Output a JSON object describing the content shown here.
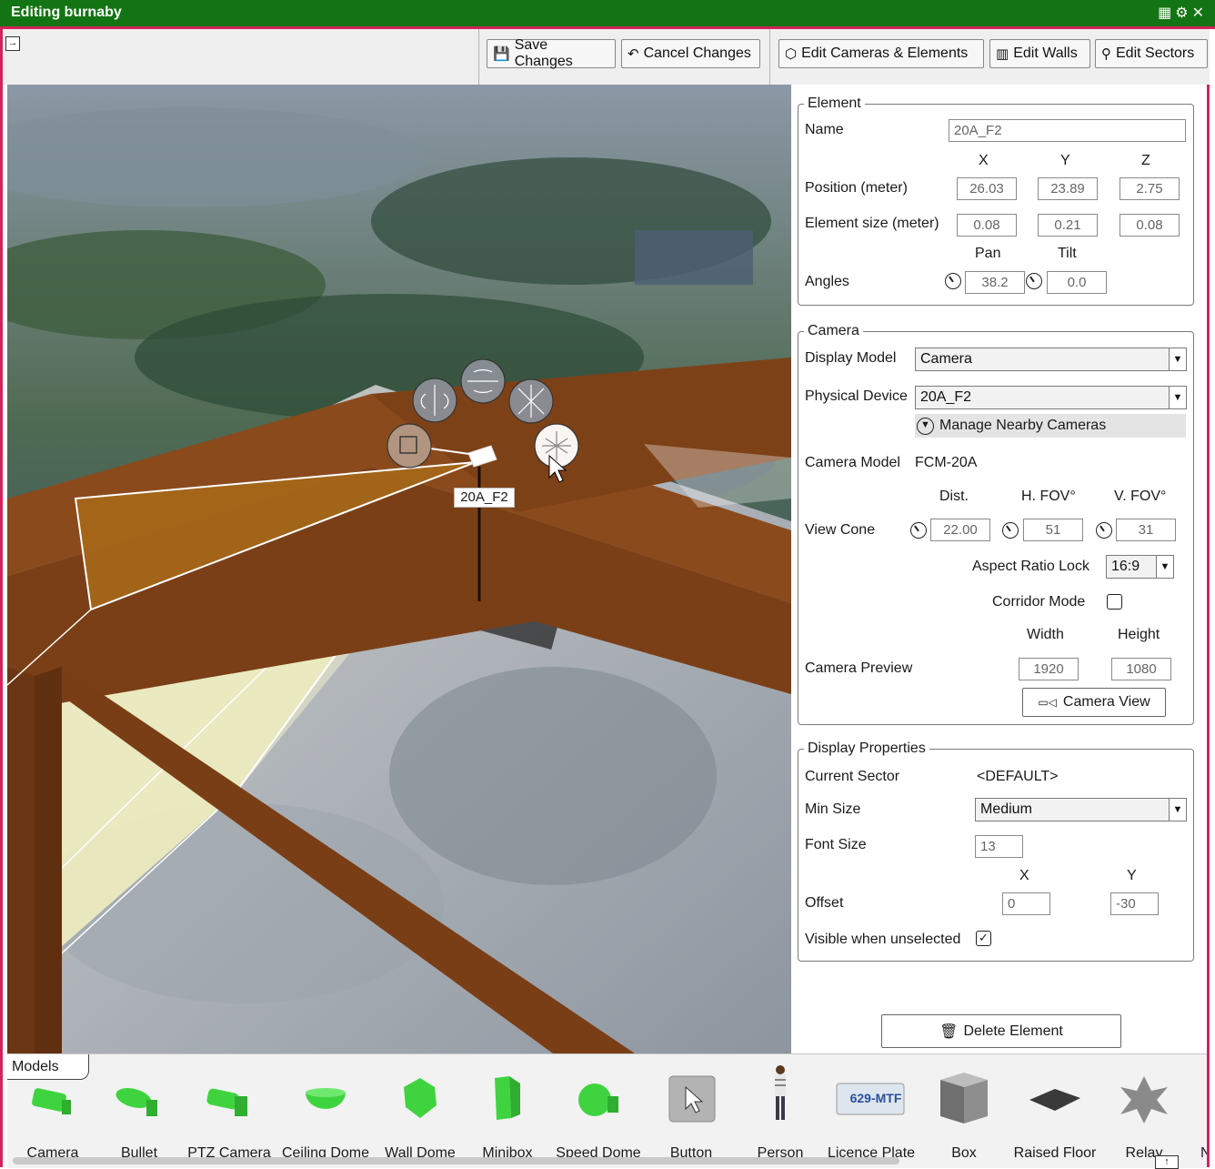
{
  "window": {
    "title": "Editing burnaby",
    "icons": [
      "layout-icon",
      "gear-icon",
      "close-icon"
    ]
  },
  "toolbar": {
    "save_label": "Save Changes",
    "cancel_label": "Cancel Changes",
    "edit_cameras_label": "Edit Cameras & Elements",
    "edit_walls_label": "Edit Walls",
    "edit_sectors_label": "Edit Sectors"
  },
  "viewport": {
    "camera_label": "20A_F2",
    "colors": {
      "wall": "#8a4a1c",
      "cone": "#f1efb8",
      "selection": "#ffffff"
    }
  },
  "element": {
    "legend": "Element",
    "name_label": "Name",
    "name_value": "20A_F2",
    "col_x": "X",
    "col_y": "Y",
    "col_z": "Z",
    "position_label": "Position (meter)",
    "position": {
      "x": "26.03",
      "y": "23.89",
      "z": "2.75"
    },
    "size_label": "Element size (meter)",
    "size": {
      "x": "0.08",
      "y": "0.21",
      "z": "0.08"
    },
    "pan_label": "Pan",
    "tilt_label": "Tilt",
    "angles_label": "Angles",
    "pan": "38.2",
    "tilt": "0.0"
  },
  "camera": {
    "legend": "Camera",
    "display_model_label": "Display Model",
    "display_model": "Camera",
    "physical_device_label": "Physical Device",
    "physical_device": "20A_F2",
    "manage_nearby": "Manage Nearby Cameras",
    "camera_model_label": "Camera Model",
    "camera_model": "FCM-20A",
    "dist_label": "Dist.",
    "hfov_label": "H. FOV°",
    "vfov_label": "V. FOV°",
    "view_cone_label": "View Cone",
    "dist": "22.00",
    "hfov": "51",
    "vfov": "31",
    "aspect_label": "Aspect Ratio Lock",
    "aspect": "16:9",
    "corridor_label": "Corridor Mode",
    "corridor_checked": false,
    "width_label": "Width",
    "height_label": "Height",
    "preview_label": "Camera Preview",
    "width": "1920",
    "height": "1080",
    "camera_view_button": "Camera View"
  },
  "display": {
    "legend": "Display Properties",
    "sector_label": "Current Sector",
    "sector": "<DEFAULT>",
    "min_size_label": "Min Size",
    "min_size": "Medium",
    "font_size_label": "Font Size",
    "font_size": "13",
    "col_x": "X",
    "col_y": "Y",
    "offset_label": "Offset",
    "offset_x": "0",
    "offset_y": "-30",
    "visible_label": "Visible when unselected",
    "visible_checked": true
  },
  "delete_button": "Delete Element",
  "models": {
    "tab_label": "Models",
    "items": [
      {
        "label": "Camera",
        "icon": "camera-model-icon"
      },
      {
        "label": "Bullet",
        "icon": "bullet-model-icon"
      },
      {
        "label": "PTZ Camera",
        "icon": "ptz-model-icon"
      },
      {
        "label": "Ceiling Dome",
        "icon": "ceiling-dome-icon"
      },
      {
        "label": "Wall Dome",
        "icon": "wall-dome-icon"
      },
      {
        "label": "Minibox",
        "icon": "minibox-icon"
      },
      {
        "label": "Speed Dome",
        "icon": "speed-dome-icon"
      },
      {
        "label": "Button",
        "icon": "button-model-icon"
      },
      {
        "label": "Person",
        "icon": "person-model-icon"
      },
      {
        "label": "Licence Plate",
        "icon": "licence-plate-icon"
      },
      {
        "label": "Box",
        "icon": "box-model-icon"
      },
      {
        "label": "Raised Floor",
        "icon": "raised-floor-icon"
      },
      {
        "label": "Relay",
        "icon": "relay-model-icon"
      },
      {
        "label": "N",
        "icon": "next-model-icon"
      }
    ],
    "plate_text": "629-MTF",
    "model_color": "#3fd43f"
  }
}
